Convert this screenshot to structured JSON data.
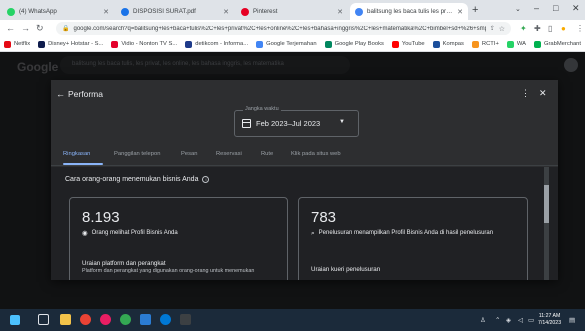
{
  "browser": {
    "tabs": [
      {
        "label": "(4) WhatsApp",
        "color": "#25d366",
        "active": false
      },
      {
        "label": "DISPOSISI SURAT.pdf",
        "color": "#1a73e8",
        "active": false
      },
      {
        "label": "Pinterest",
        "color": "#e60023",
        "active": false
      },
      {
        "label": "balitsung les baca tulis les privat",
        "color": "#4285f4",
        "active": true
      }
    ],
    "new_tab": "+",
    "window_controls": {
      "minimize": "–",
      "maximize": "□",
      "close": "✕"
    },
    "url": "google.com/search?q=balitsung+les+baca+tulis%2C+les+privat%2C+les+online%2C+les+bahasa+inggris%2C+les+matematika%2C+bimbel+sd+%26+smp&oq...",
    "bookmarks": [
      {
        "label": "Netflix",
        "color": "#e50914"
      },
      {
        "label": "Disney+ Hotstar - S...",
        "color": "#0f1c4d"
      },
      {
        "label": "Vidio - Nonton TV S...",
        "color": "#e4002b"
      },
      {
        "label": "detikcom - Informa...",
        "color": "#1e3a8a"
      },
      {
        "label": "Google Terjemahan",
        "color": "#4285f4"
      },
      {
        "label": "Google Play Books",
        "color": "#01875f"
      },
      {
        "label": "YouTube",
        "color": "#ff0000"
      },
      {
        "label": "Kompas",
        "color": "#1c4f9c"
      },
      {
        "label": "RCTI+",
        "color": "#f7941d"
      },
      {
        "label": "WA",
        "color": "#25d366"
      },
      {
        "label": "GrabMerchant",
        "color": "#00b14f"
      }
    ]
  },
  "background": {
    "logo": "Google",
    "search_text": "balitsung les baca tulis, les privat, les online, les bahasa inggris, les matematika"
  },
  "dialog": {
    "title": "Performa",
    "date_range": {
      "legend": "Jangka waktu",
      "value": "Feb 2023–Jul 2023"
    },
    "tabs": [
      "Ringkasan",
      "Panggilan telepon",
      "Pesan",
      "Reservasi",
      "Rute",
      "Klik pada situs web"
    ],
    "section_heading": "Cara orang-orang menemukan bisnis Anda",
    "cards": [
      {
        "number": "8.193",
        "metric_icon": "eye-icon",
        "metric_label": "Orang melihat Profil Bisnis Anda",
        "sub_title": "Uraian platform dan perangkat",
        "sub_desc": "Platform dan perangkat yang digunakan orang-orang untuk menemukan"
      },
      {
        "number": "783",
        "metric_icon": "search-icon",
        "metric_label": "Penelusuran menampilkan Profil Bisnis Anda di hasil penelusuran",
        "sub_title": "Uraian kueri penelusuran"
      }
    ]
  },
  "taskbar": {
    "time": "11:27 AM",
    "date": "7/14/2023"
  },
  "colors": {
    "accent": "#8ab4f8",
    "dialog_bg": "#2d2e30",
    "page_bg": "#202124"
  }
}
